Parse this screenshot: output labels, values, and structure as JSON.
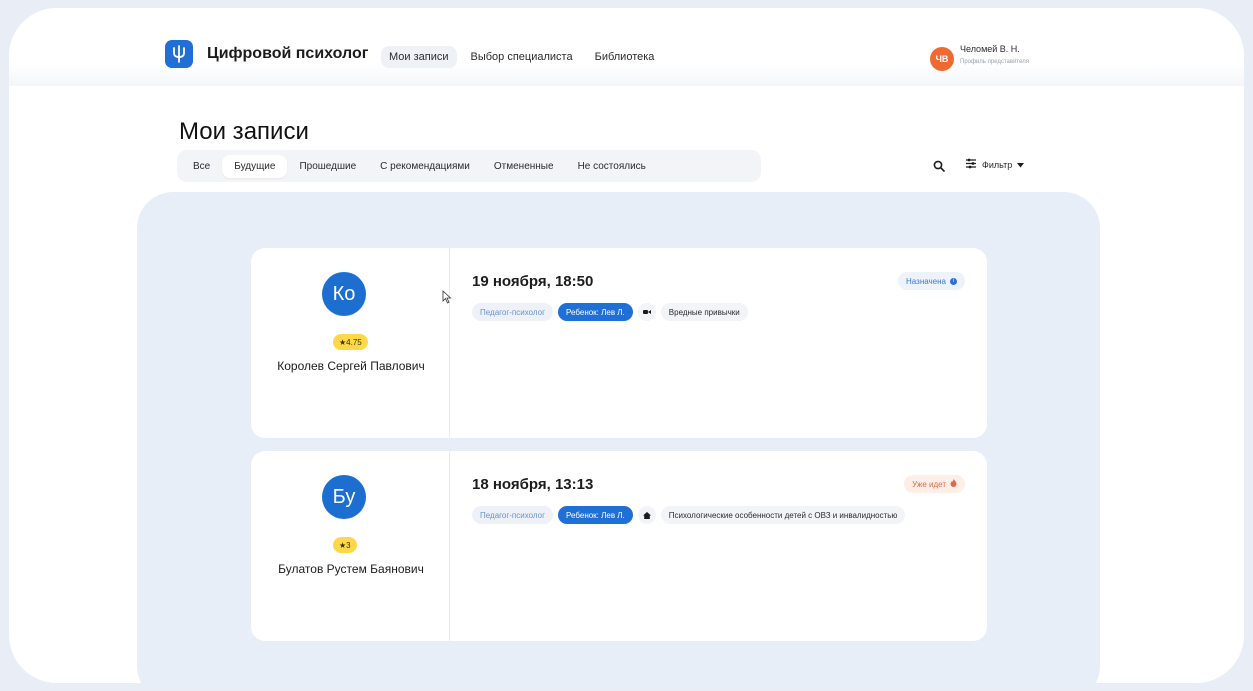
{
  "header": {
    "brand": "Цифровой психолог",
    "nav": [
      "Мои записи",
      "Выбор специалиста",
      "Библиотека"
    ],
    "user": {
      "initials": "ЧВ",
      "name": "Челомей В. Н.",
      "role": "Профиль представителя"
    }
  },
  "page": {
    "title": "Мои записи",
    "tabs": [
      "Все",
      "Будущие",
      "Прошедшие",
      "С рекомендациями",
      "Отмененные",
      "Не состоялись"
    ],
    "filter_label": "Фильтр"
  },
  "appointments": [
    {
      "initials": "Ко",
      "rating": "★4.75",
      "name": "Королев Сергей Павлович",
      "date": "19 ноября, 18:50",
      "status": "Назначена",
      "tags": [
        "Педагог-психолог",
        "Ребенок: Лев Л.",
        "Вредные привычки"
      ]
    },
    {
      "initials": "Бу",
      "rating": "★3",
      "name": "Булатов Рустем Баянович",
      "date": "18 ноября, 13:13",
      "status": "Уже идет",
      "tags": [
        "Педагог-психолог",
        "Ребенок: Лев Л.",
        "Психологические особенности детей с ОВЗ и инвалидностью"
      ]
    }
  ],
  "colors": {
    "accent": "#1e6fd6",
    "avatar_user": "#ee6a32",
    "rating": "#ffd84a"
  }
}
